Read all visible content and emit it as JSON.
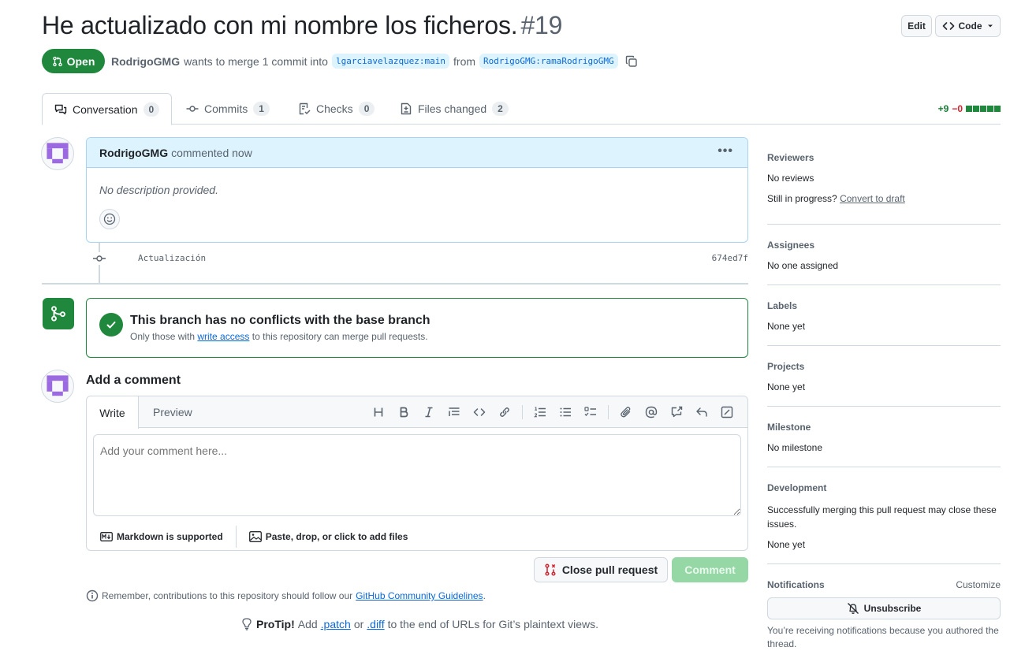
{
  "header": {
    "title": "He actualizado con mi nombre los ficheros.",
    "number": "#19",
    "edit_label": "Edit",
    "code_label": "Code"
  },
  "status": {
    "state": "Open",
    "author": "RodrigoGMG",
    "action_text": "wants to merge 1 commit into",
    "base_branch": "lgarciavelazquez:main",
    "from_text": "from",
    "head_branch": "RodrigoGMG:ramaRodrigoGMG"
  },
  "tabs": [
    {
      "label": "Conversation",
      "count": "0",
      "icon": "comment-discussion-icon"
    },
    {
      "label": "Commits",
      "count": "1",
      "icon": "git-commit-icon"
    },
    {
      "label": "Checks",
      "count": "0",
      "icon": "checklist-icon"
    },
    {
      "label": "Files changed",
      "count": "2",
      "icon": "file-diff-icon"
    }
  ],
  "diffstat": {
    "additions": "+9",
    "deletions": "−0",
    "blocks": 5,
    "colors": {
      "add": "#1a7f37",
      "del": "#d1242f"
    }
  },
  "comment": {
    "author": "RodrigoGMG",
    "time": "commented now",
    "body": "No description provided."
  },
  "commit": {
    "message": "Actualización",
    "sha": "674ed7f"
  },
  "merge": {
    "title": "This branch has no conflicts with the base branch",
    "sub_before": "Only those with",
    "sub_link": "write access",
    "sub_after": "to this repository can merge pull requests."
  },
  "new_comment": {
    "heading": "Add a comment",
    "write_tab": "Write",
    "preview_tab": "Preview",
    "placeholder": "Add your comment here...",
    "markdown_note": "Markdown is supported",
    "attach_note": "Paste, drop, or click to add files",
    "close_button": "Close pull request",
    "comment_button": "Comment"
  },
  "footer": {
    "remember_before": "Remember, contributions to this repository should follow our",
    "remember_link": "GitHub Community Guidelines",
    "remember_after": ".",
    "protip_label": "ProTip!",
    "protip_before": "Add",
    "protip_patch": ".patch",
    "protip_or": "or",
    "protip_diff": ".diff",
    "protip_after": "to the end of URLs for Git’s plaintext views."
  },
  "sidebar": {
    "reviewers": {
      "heading": "Reviewers",
      "value": "No reviews",
      "progress_text": "Still in progress?",
      "progress_link": "Convert to draft"
    },
    "assignees": {
      "heading": "Assignees",
      "value": "No one assigned"
    },
    "labels": {
      "heading": "Labels",
      "value": "None yet"
    },
    "projects": {
      "heading": "Projects",
      "value": "None yet"
    },
    "milestone": {
      "heading": "Milestone",
      "value": "No milestone"
    },
    "development": {
      "heading": "Development",
      "note": "Successfully merging this pull request may close these issues.",
      "value": "None yet"
    },
    "notifications": {
      "heading": "Notifications",
      "customize": "Customize",
      "button": "Unsubscribe",
      "note": "You’re receiving notifications because you authored the thread."
    }
  },
  "colors": {
    "accent_green": "#1f883d",
    "link_blue": "#0969da",
    "avatar_purple": "#9c6ae0"
  }
}
